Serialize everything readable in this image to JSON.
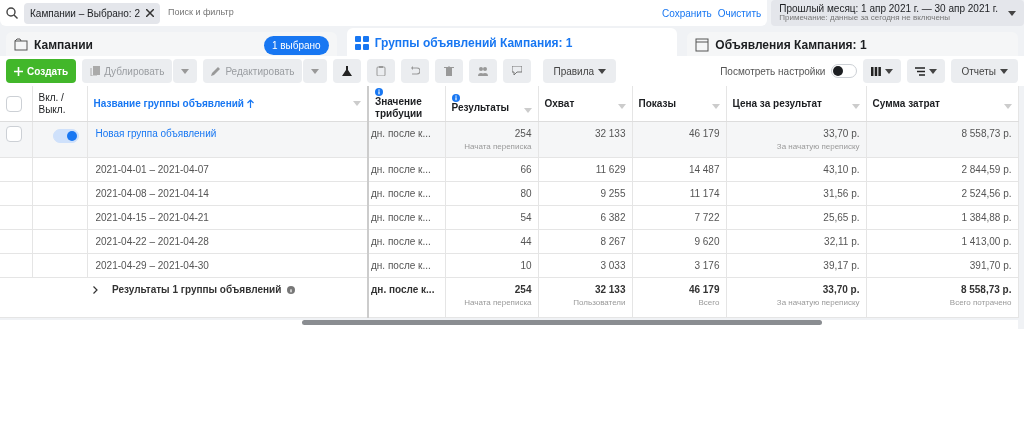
{
  "filter_bar": {
    "chip": "Кампании – Выбрано: 2",
    "placeholder": "Поиск и фильтр",
    "save": "Сохранить",
    "clear": "Очистить"
  },
  "date_range": {
    "label": "Прошлый месяц: 1 апр 2021 г. — 30 апр 2021 г.",
    "note": "Примечание: данные за сегодня не включены"
  },
  "tabs": [
    {
      "label": "Кампании",
      "selected": false,
      "badge": "1 выбрано"
    },
    {
      "label": "Группы объявлений Кампания: 1",
      "selected": true
    },
    {
      "label": "Объявления Кампания: 1",
      "selected": false
    }
  ],
  "toolbar": {
    "create": "Создать",
    "duplicate": "Дублировать",
    "edit": "Редактировать",
    "rules": "Правила",
    "view_settings": "Посмотреть настройки",
    "view_settings_on": false,
    "reports": "Отчеты"
  },
  "table": {
    "fixed_columns": [
      {
        "kind": "select",
        "checked": false
      },
      {
        "label": "Вкл. / Выкл."
      },
      {
        "label": "Название группы объявлений",
        "sorted": true
      }
    ],
    "columns": [
      {
        "label": "Значение трибуции",
        "info": true
      },
      {
        "label": "Результаты",
        "info": true
      },
      {
        "label": "Охват"
      },
      {
        "label": "Показы"
      },
      {
        "label": "Цена за результат"
      },
      {
        "label": "Сумма затрат"
      }
    ],
    "rows": [
      {
        "kind": "adset",
        "checked": false,
        "name": "Новая группа объявлений",
        "on": true,
        "cells": [
          {
            "value": "дн. после к..."
          },
          {
            "value": "254",
            "note": "Начата переписка"
          },
          {
            "value": "32 133"
          },
          {
            "value": "46 179"
          },
          {
            "value": "33,70 р.",
            "note": "За начатую переписку"
          },
          {
            "value": "8 558,73 р."
          }
        ]
      },
      {
        "kind": "breakdown",
        "name": "2021-04-01 – 2021-04-07",
        "cells": [
          {
            "value": "дн. после к..."
          },
          {
            "value": "66"
          },
          {
            "value": "11 629"
          },
          {
            "value": "14 487"
          },
          {
            "value": "43,10 р."
          },
          {
            "value": "2 844,59 р."
          }
        ]
      },
      {
        "kind": "breakdown",
        "name": "2021-04-08 – 2021-04-14",
        "cells": [
          {
            "value": "дн. после к..."
          },
          {
            "value": "80"
          },
          {
            "value": "9 255"
          },
          {
            "value": "11 174"
          },
          {
            "value": "31,56 р."
          },
          {
            "value": "2 524,56 р."
          }
        ]
      },
      {
        "kind": "breakdown",
        "name": "2021-04-15 – 2021-04-21",
        "cells": [
          {
            "value": "дн. после к..."
          },
          {
            "value": "54"
          },
          {
            "value": "6 382"
          },
          {
            "value": "7 722"
          },
          {
            "value": "25,65 р."
          },
          {
            "value": "1 384,88 р."
          }
        ]
      },
      {
        "kind": "breakdown",
        "name": "2021-04-22 – 2021-04-28",
        "cells": [
          {
            "value": "дн. после к..."
          },
          {
            "value": "44"
          },
          {
            "value": "8 267"
          },
          {
            "value": "9 620"
          },
          {
            "value": "32,11 р."
          },
          {
            "value": "1 413,00 р."
          }
        ]
      },
      {
        "kind": "breakdown",
        "name": "2021-04-29 – 2021-04-30",
        "cells": [
          {
            "value": "дн. после к..."
          },
          {
            "value": "10"
          },
          {
            "value": "3 033"
          },
          {
            "value": "3 176"
          },
          {
            "value": "39,17 р."
          },
          {
            "value": "391,70 р."
          }
        ]
      }
    ],
    "total": {
      "label": "Результаты 1 группы объявлений",
      "cells": [
        {
          "value": "дн. после к..."
        },
        {
          "value": "254",
          "note": "Начата переписка"
        },
        {
          "value": "32 133",
          "note": "Пользователи"
        },
        {
          "value": "46 179",
          "note": "Всего"
        },
        {
          "value": "33,70 р.",
          "note": "За начатую переписку"
        },
        {
          "value": "8 558,73 р.",
          "note": "Всего потрачено"
        }
      ]
    }
  }
}
